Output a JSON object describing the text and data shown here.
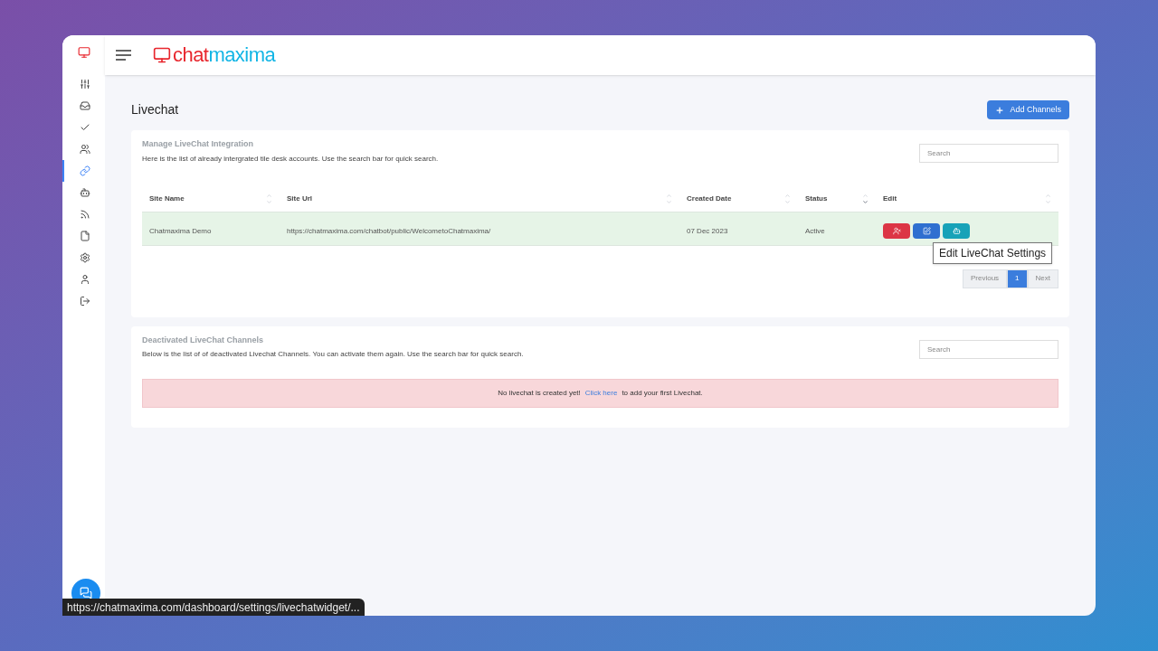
{
  "sidebar": {
    "items": [
      {
        "kind": "sliders",
        "selected": false
      },
      {
        "kind": "inbox",
        "selected": false
      },
      {
        "kind": "check",
        "selected": false
      },
      {
        "kind": "users",
        "selected": false
      },
      {
        "kind": "link",
        "selected": true
      },
      {
        "kind": "bot",
        "selected": false
      },
      {
        "kind": "rss",
        "selected": false
      },
      {
        "kind": "file",
        "selected": false
      },
      {
        "kind": "settings",
        "selected": false
      },
      {
        "kind": "user",
        "selected": false
      },
      {
        "kind": "logout",
        "selected": false
      }
    ]
  },
  "header": {
    "brand_first": "chat",
    "brand_second": "maxima"
  },
  "page_title": "Livechat",
  "add_button": "Add Channels",
  "active_section": {
    "title": "Manage LiveChat Integration",
    "description": "Here is the list of already intergrated tile desk accounts. Use the search bar for quick search.",
    "search": {
      "placeholder": "Search"
    },
    "table": {
      "columns": [
        {
          "label": "Site Name",
          "sorted": false
        },
        {
          "label": "Site Url",
          "sorted": false
        },
        {
          "label": "Created Date",
          "sorted": false
        },
        {
          "label": "Status",
          "sorted": true
        },
        {
          "label": "Edit",
          "sorted": false
        }
      ],
      "rows": [
        {
          "site_name": "Chatmaxima Demo",
          "site_url": "https://chatmaxima.com/chatbot/public/WelcometoChatmaxima/",
          "created_date": "07 Dec 2023",
          "status": "Active",
          "actions": [
            {
              "kind": "deactivate"
            },
            {
              "kind": "edit"
            },
            {
              "kind": "bot"
            }
          ]
        }
      ]
    },
    "tooltip": "Edit LiveChat Settings",
    "pagination": [
      {
        "label": "Previous",
        "selected": false
      },
      {
        "label": "1",
        "selected": true
      },
      {
        "label": "Next",
        "selected": false
      }
    ]
  },
  "deactivated_section": {
    "title": "Deactivated LiveChat Channels",
    "description": "Below is the list of of deactivated Livechat Channels. You can activate them again. Use the search bar for quick search.",
    "search": {
      "placeholder": "Search"
    },
    "alert": {
      "before": "No livechat is created yet!",
      "link": "Click here",
      "after": "to add your first Livechat."
    }
  },
  "status_bar": "https://chatmaxima.com/dashboard/settings/livechatwidget/..."
}
